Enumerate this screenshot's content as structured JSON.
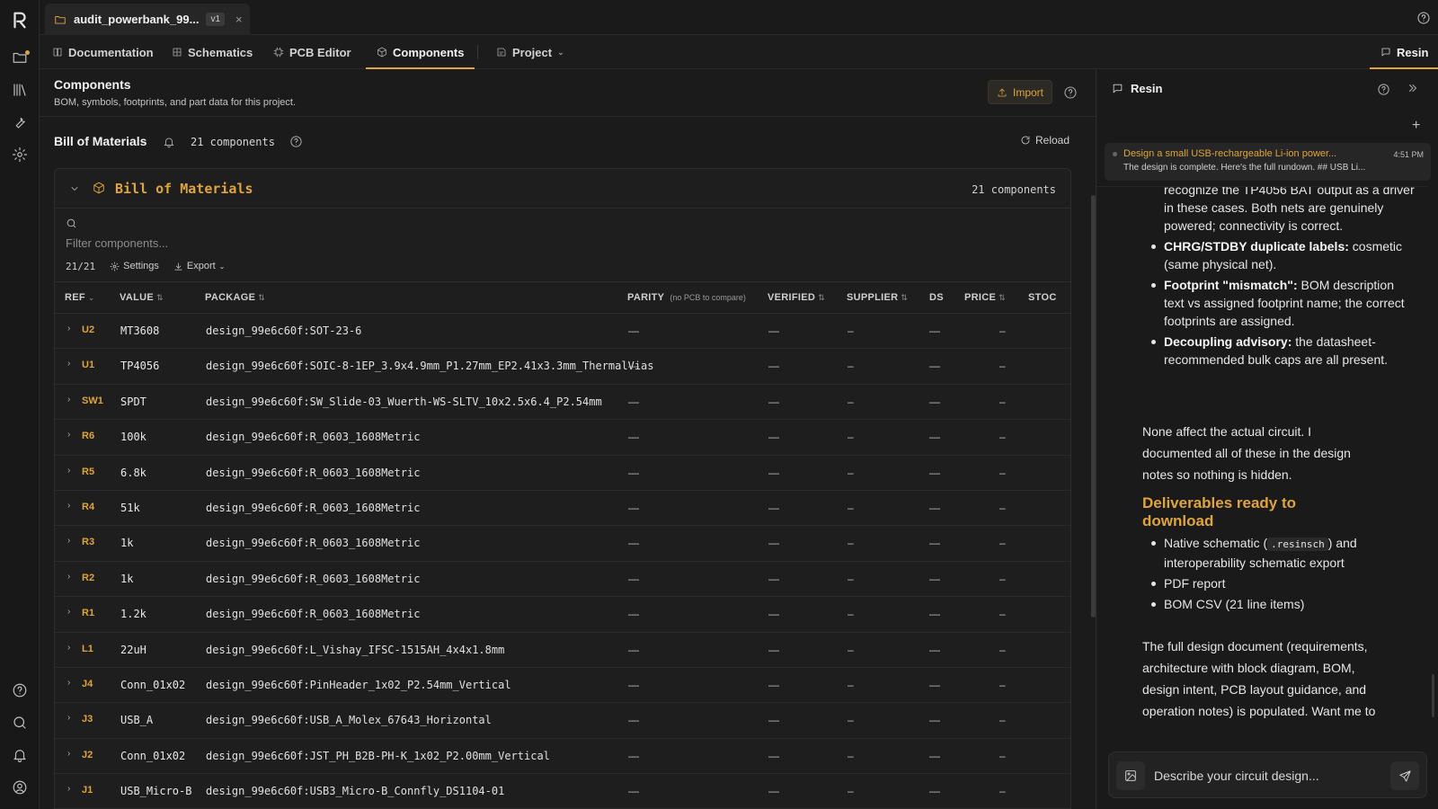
{
  "file_tab": {
    "name": "audit_powerbank_99...",
    "version": "v1",
    "close": "×"
  },
  "nav": {
    "tabs": [
      {
        "label": "Documentation",
        "icon": "book-icon"
      },
      {
        "label": "Schematics",
        "icon": "schematic-icon"
      },
      {
        "label": "PCB Editor",
        "icon": "chip-icon"
      },
      {
        "label": "Components",
        "icon": "cube-icon",
        "active": true
      },
      {
        "label": "Project",
        "icon": "project-icon"
      }
    ],
    "right_label": "Resin"
  },
  "header": {
    "title": "Components",
    "subtitle": "BOM, symbols, footprints, and part data for this project.",
    "import_label": "Import"
  },
  "bom": {
    "title": "Bill of Materials",
    "count": "21 components",
    "reload_label": "Reload",
    "card_title": "Bill of Materials",
    "card_count": "21 components",
    "filter_placeholder": "Filter components...",
    "shown_count": "21/21",
    "settings_label": "Settings",
    "export_label": "Export"
  },
  "table": {
    "columns": {
      "ref": "REF",
      "value": "VALUE",
      "package": "PACKAGE",
      "parity": "PARITY",
      "parity_note": "(no PCB to compare)",
      "verified": "VERIFIED",
      "supplier": "SUPPLIER",
      "ds": "DS",
      "price": "PRICE",
      "stock": "STOC"
    },
    "rows": [
      {
        "ref": "U2",
        "value": "MT3608",
        "package": "design_99e6c60f:SOT-23-6"
      },
      {
        "ref": "U1",
        "value": "TP4056",
        "package": "design_99e6c60f:SOIC-8-1EP_3.9x4.9mm_P1.27mm_EP2.41x3.3mm_ThermalVias"
      },
      {
        "ref": "SW1",
        "value": "SPDT",
        "package": "design_99e6c60f:SW_Slide-03_Wuerth-WS-SLTV_10x2.5x6.4_P2.54mm"
      },
      {
        "ref": "R6",
        "value": "100k",
        "package": "design_99e6c60f:R_0603_1608Metric"
      },
      {
        "ref": "R5",
        "value": "6.8k",
        "package": "design_99e6c60f:R_0603_1608Metric"
      },
      {
        "ref": "R4",
        "value": "51k",
        "package": "design_99e6c60f:R_0603_1608Metric"
      },
      {
        "ref": "R3",
        "value": "1k",
        "package": "design_99e6c60f:R_0603_1608Metric"
      },
      {
        "ref": "R2",
        "value": "1k",
        "package": "design_99e6c60f:R_0603_1608Metric"
      },
      {
        "ref": "R1",
        "value": "1.2k",
        "package": "design_99e6c60f:R_0603_1608Metric"
      },
      {
        "ref": "L1",
        "value": "22uH",
        "package": "design_99e6c60f:L_Vishay_IFSC-1515AH_4x4x1.8mm"
      },
      {
        "ref": "J4",
        "value": "Conn_01x02",
        "package": "design_99e6c60f:PinHeader_1x02_P2.54mm_Vertical"
      },
      {
        "ref": "J3",
        "value": "USB_A",
        "package": "design_99e6c60f:USB_A_Molex_67643_Horizontal"
      },
      {
        "ref": "J2",
        "value": "Conn_01x02",
        "package": "design_99e6c60f:JST_PH_B2B-PH-K_1x02_P2.00mm_Vertical"
      },
      {
        "ref": "J1",
        "value": "USB_Micro-B",
        "package": "design_99e6c60f:USB3_Micro-B_Connfly_DS1104-01"
      }
    ],
    "dash_long": "—",
    "dash_short": "–"
  },
  "panel": {
    "title": "Resin",
    "conversation": {
      "title": "Design a small USB-rechargeable Li-ion power...",
      "time": "4:51 PM",
      "preview": "The design is complete. Here's the full rundown. ## USB Li..."
    },
    "chat": {
      "intro_lines": "recognize the TP4056 BAT output as a driver in these cases. Both nets are genuinely powered; connectivity is correct.",
      "bullets": [
        {
          "bold": "CHRG/STDBY duplicate labels:",
          "text": " cosmetic (same physical net)."
        },
        {
          "bold": "Footprint \"mismatch\":",
          "text": " BOM description text vs assigned footprint name; the correct footprints are assigned."
        },
        {
          "bold": "Decoupling advisory:",
          "text": " the datasheet-recommended bulk caps are all present."
        }
      ],
      "para1": "None affect the actual circuit. I documented all of these in the design notes so nothing is hidden.",
      "heading": "Deliverables ready to download",
      "deliverables_1_pre": "Native schematic (",
      "deliverables_1_code": ".resinsch",
      "deliverables_1_post": ") and interoperability schematic export",
      "deliverables_2": "PDF report",
      "deliverables_3": "BOM CSV (21 line items)",
      "para2": "The full design document (requirements, architecture with block diagram, BOM, design intent, PCB layout guidance, and operation notes) is populated. Want me to bump the"
    },
    "input_placeholder": "Describe your circuit design..."
  },
  "colors": {
    "accent": "#e0a43c",
    "background": "#1b1b1b"
  }
}
